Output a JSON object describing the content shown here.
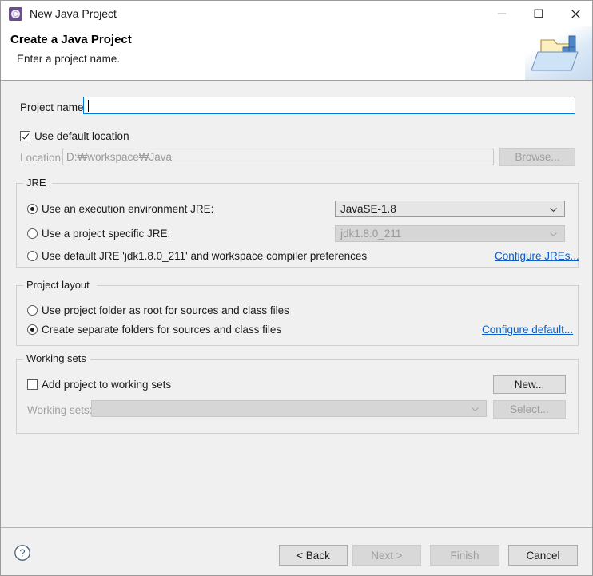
{
  "window": {
    "title": "New Java Project",
    "icon": "eclipse-wizard-icon",
    "controls": {
      "minimize": "minimize-icon",
      "maximize": "maximize-icon",
      "close": "close-icon"
    }
  },
  "banner": {
    "title": "Create a Java Project",
    "subtitle": "Enter a project name.",
    "artwork": "java-project-folder-icon"
  },
  "project": {
    "name_label": "Project name:",
    "name_value": "",
    "name_placeholder": "",
    "use_default_location_label": "Use default location",
    "use_default_location_checked": true,
    "location_label": "Location:",
    "location_value": "D:₩workspace₩Java",
    "browse_label": "Browse..."
  },
  "jre": {
    "group_label": "JRE",
    "option_execution_env": "Use an execution environment JRE:",
    "option_project_specific": "Use a project specific JRE:",
    "option_default_jre": "Use default JRE 'jdk1.8.0_211' and workspace compiler preferences",
    "selected": "execution_env",
    "execution_env_value": "JavaSE-1.8",
    "project_specific_value": "jdk1.8.0_211",
    "configure_link": "Configure JREs..."
  },
  "project_layout": {
    "group_label": "Project layout",
    "option_root": "Use project folder as root for sources and class files",
    "option_separate": "Create separate folders for sources and class files",
    "selected": "separate",
    "configure_link": "Configure default..."
  },
  "working_sets": {
    "group_label": "Working sets",
    "add_checkbox_label": "Add project to working sets",
    "add_checked": false,
    "working_sets_label": "Working sets:",
    "working_sets_value": "",
    "new_label": "New...",
    "select_label": "Select..."
  },
  "footer": {
    "help": "help-icon",
    "back_label": "< Back",
    "next_label": "Next >",
    "finish_label": "Finish",
    "cancel_label": "Cancel",
    "back_enabled": true,
    "next_enabled": false,
    "finish_enabled": false,
    "cancel_enabled": true
  },
  "colors": {
    "dialog_bg": "#f0f0f0",
    "header_bg": "#ffffff",
    "link": "#0b5ec7",
    "focus_border": "#0078d7",
    "title_icon": "#6b4e8e"
  }
}
